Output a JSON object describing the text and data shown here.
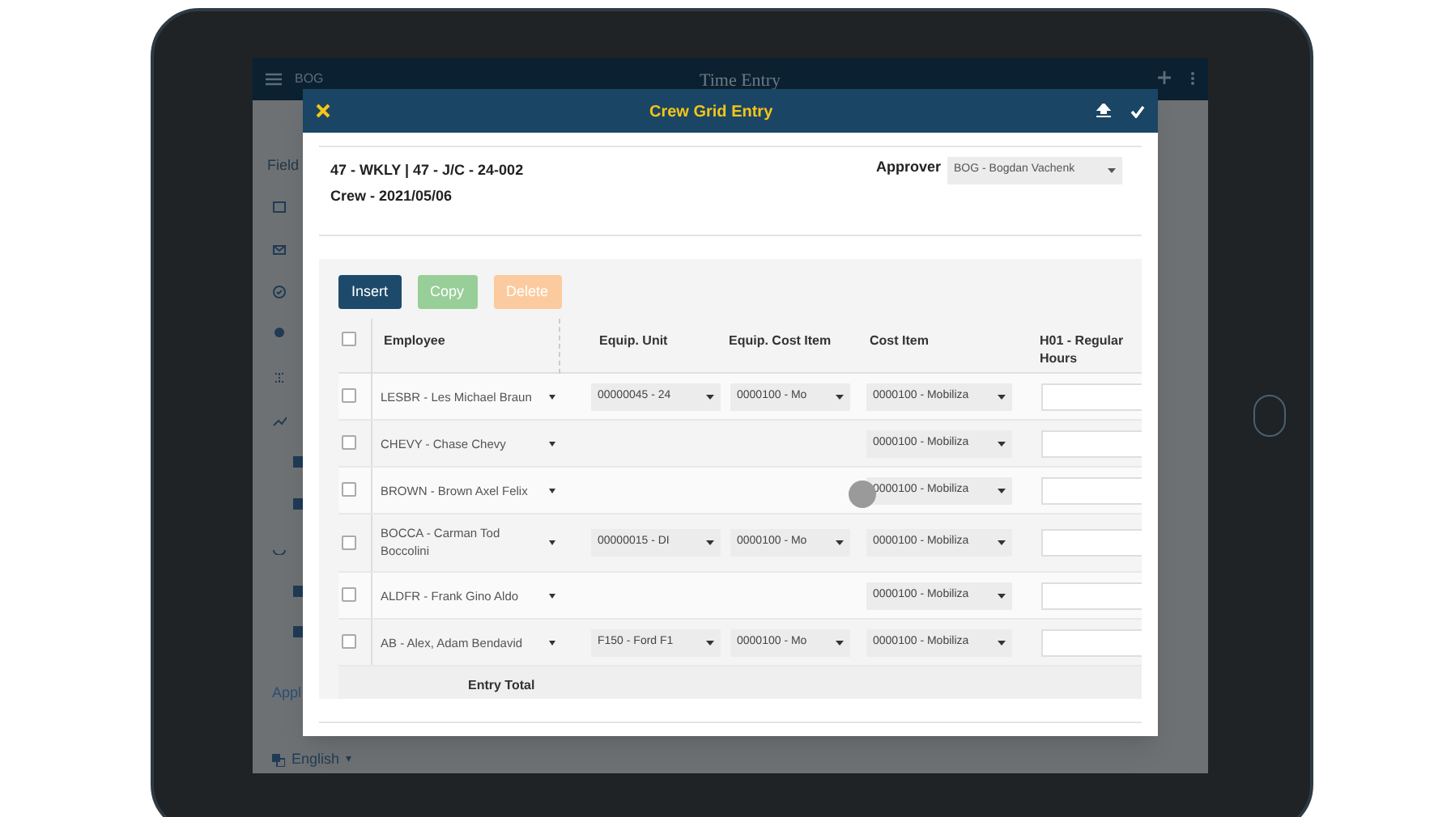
{
  "app": {
    "menu_text": "BOG",
    "title": "Time Entry",
    "sidebar_heading": "Field",
    "sidebar_link": "Appl",
    "language": "English",
    "language_caret": "▾"
  },
  "modal": {
    "title": "Crew Grid Entry",
    "info_line_1": "47 - WKLY | 47 - J/C - 24-002",
    "info_line_2": "Crew - 2021/05/06",
    "approver_label": "Approver",
    "approver_value": "BOG - Bogdan Vachenk",
    "buttons": [
      {
        "label": "Insert",
        "color": "#1d4a6b"
      },
      {
        "label": "Copy",
        "color": "#98cf98"
      },
      {
        "label": "Delete",
        "color": "#fbcb9f"
      }
    ],
    "table": {
      "all_selected": false,
      "columns": [
        "Employee",
        "Equip. Unit",
        "Equip. Cost Item",
        "Cost Item",
        "H01 - Regular Hours"
      ],
      "rows": [
        {
          "selected": false,
          "employee": "LESBR - Les Michael Braun",
          "equip_unit": "00000045 - 24",
          "equip_cost_item": "0000100 - Mo",
          "cost_item": "0000100 - Mobiliza"
        },
        {
          "selected": false,
          "employee": "CHEVY - Chase Chevy",
          "cost_item": "0000100 - Mobiliza"
        },
        {
          "selected": false,
          "employee": "BROWN - Brown Axel Felix",
          "cost_item": "0000100 - Mobiliza"
        },
        {
          "selected": false,
          "employee": "BOCCA - Carman Tod Boccolini",
          "equip_unit": "00000015 - DI",
          "equip_cost_item": "0000100 - Mo",
          "cost_item": "0000100 - Mobiliza"
        },
        {
          "selected": false,
          "employee": "ALDFR - Frank Gino Aldo",
          "cost_item": "0000100 - Mobiliza"
        },
        {
          "selected": false,
          "employee": "AB - Alex, Adam Bendavid",
          "equip_unit": "F150 - Ford F1",
          "equip_cost_item": "0000100 - Mo",
          "cost_item": "0000100 - Mobiliza"
        }
      ],
      "total_label": "Entry Total"
    }
  }
}
